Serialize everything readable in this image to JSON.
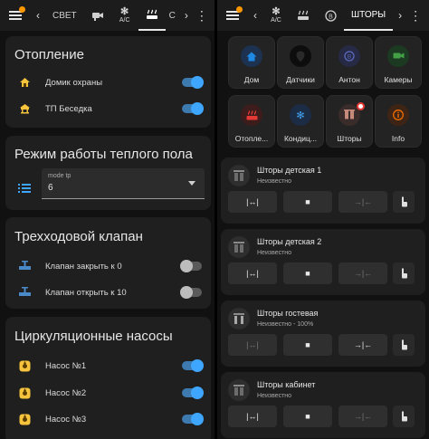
{
  "left": {
    "topbar": {
      "tabs": [
        {
          "label": "СВЕТ"
        },
        {
          "label": "",
          "icon": "camera-icon"
        },
        {
          "label": "A/C",
          "icon": "snowflake-icon"
        },
        {
          "label": "",
          "icon": "heater-icon",
          "active": true
        },
        {
          "label": "C",
          "icon": ""
        }
      ],
      "back": "‹",
      "forward": "›",
      "more": "⋮"
    },
    "heating": {
      "title": "Отопление",
      "rows": [
        {
          "label": "Домик охраны",
          "state": "on"
        },
        {
          "label": "ТП Беседка",
          "state": "on"
        }
      ]
    },
    "floor": {
      "title": "Режим работы теплого пола",
      "select_label": "mode tp",
      "select_value": "6"
    },
    "valve": {
      "title": "Трехходовой клапан",
      "rows": [
        {
          "label": "Клапан закрыть к 0",
          "state": "off"
        },
        {
          "label": "Клапан открыть к 10",
          "state": "off"
        }
      ]
    },
    "pumps": {
      "title": "Циркуляционные насосы",
      "rows": [
        {
          "label": "Насос №1",
          "state": "on"
        },
        {
          "label": "Насос №2",
          "state": "on"
        },
        {
          "label": "Насос №3",
          "state": "on"
        }
      ]
    }
  },
  "right": {
    "topbar": {
      "tabs": [
        {
          "label": "A/C"
        },
        {
          "label": "",
          "icon": "heater-icon"
        },
        {
          "label": "",
          "icon": "b-circle-icon"
        },
        {
          "label": "ШТОРЫ",
          "active": true
        }
      ],
      "back": "‹",
      "forward": "›",
      "more": "⋮"
    },
    "tiles": [
      {
        "label": "Дом",
        "icon": "home-icon",
        "color": "#1e88e5",
        "bg": "#1c3250"
      },
      {
        "label": "Датчики",
        "icon": "pin-icon",
        "color": "#111111",
        "bg": "#0d0d0d"
      },
      {
        "label": "Антон",
        "icon": "b-circle-icon",
        "color": "#5c6bc0",
        "bg": "#262a44"
      },
      {
        "label": "Камеры",
        "icon": "camera-icon",
        "color": "#43a047",
        "bg": "#1c3a22"
      },
      {
        "label": "Отопле...",
        "icon": "heater-icon",
        "color": "#e53935",
        "bg": "#3d1c1c"
      },
      {
        "label": "Кондиц...",
        "icon": "snowflake-icon",
        "color": "#42a5f5",
        "bg": "#1c2c44"
      },
      {
        "label": "Шторы",
        "icon": "blinds-icon",
        "color": "#c68a7a",
        "bg": "#3a2c2a",
        "badge": true
      },
      {
        "label": "Info",
        "icon": "info-icon",
        "color": "#ef6c00",
        "bg": "#3d2414"
      }
    ],
    "covers": [
      {
        "title": "Шторы детская 1",
        "state": "Неизвестно"
      },
      {
        "title": "Шторы детская 2",
        "state": "Неизвестно"
      },
      {
        "title": "Шторы гостевая",
        "state": "Неизвестно - 100%"
      },
      {
        "title": "Шторы кабинет",
        "state": "Неизвестно"
      }
    ],
    "cover_buttons": {
      "open": "|↔|",
      "stop": "■",
      "close": "→|←"
    }
  },
  "colors": {
    "accent": "#3ea6ff",
    "card": "#1f1f1f",
    "background": "#111111"
  }
}
